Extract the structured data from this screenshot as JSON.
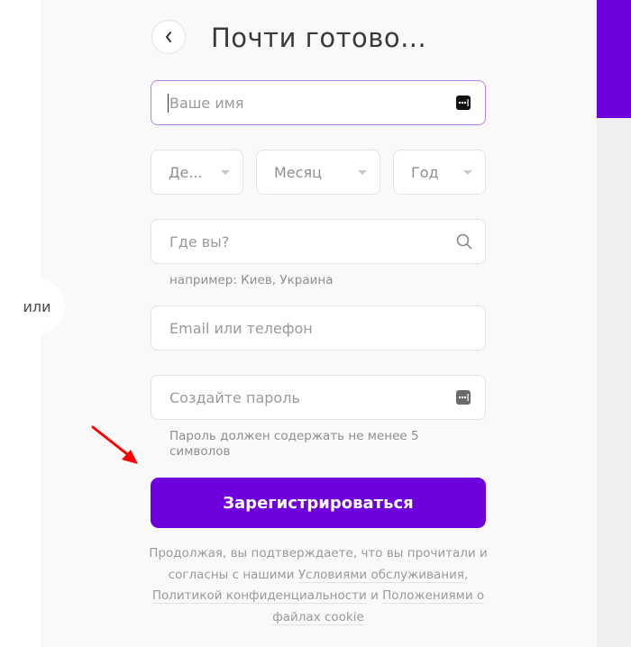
{
  "header": {
    "title": "Почти готово...",
    "back_icon": "chevron-left-icon"
  },
  "divider": {
    "or_label": "или"
  },
  "form": {
    "name": {
      "placeholder": "Ваше имя",
      "value": "",
      "icon": "password-manager-icon"
    },
    "birthdate": {
      "day": {
        "label": "Де..."
      },
      "month": {
        "label": "Месяц"
      },
      "year": {
        "label": "Год"
      }
    },
    "location": {
      "placeholder": "Где вы?",
      "value": "",
      "icon": "search-icon",
      "hint": "например: Киев, Украина"
    },
    "contact": {
      "placeholder": "Email или телефон",
      "value": ""
    },
    "password": {
      "placeholder": "Создайте пароль",
      "value": "",
      "icon": "password-manager-icon",
      "hint": "Пароль должен содержать не менее 5 символов"
    },
    "submit_label": "Зарегистрироваться"
  },
  "terms": {
    "prefix": "Продолжая, вы подтверждаете, что вы прочитали и согласны с нашими ",
    "terms_link": "Условиями обслуживания",
    "sep1": ", ",
    "privacy_link": "Политикой конфиденциальности",
    "sep2": " и ",
    "cookie_link": "Положениями о файлах cookie"
  },
  "colors": {
    "accent": "#6e00dd",
    "focus_border": "#b57ff0",
    "annotation_arrow": "#ff0000"
  }
}
